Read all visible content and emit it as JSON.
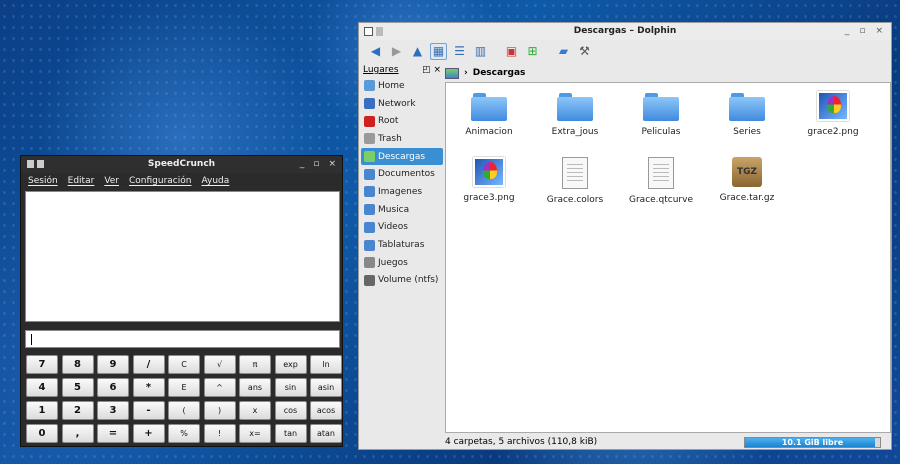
{
  "speedcrunch": {
    "title": "SpeedCrunch",
    "menu": [
      "Sesión",
      "Editar",
      "Ver",
      "Configuración",
      "Ayuda"
    ],
    "input_value": "",
    "keys": [
      [
        "7",
        "8",
        "9",
        "/",
        "C",
        "√",
        "π",
        "exp",
        "ln"
      ],
      [
        "4",
        "5",
        "6",
        "*",
        "E",
        "^",
        "ans",
        "sin",
        "asin"
      ],
      [
        "1",
        "2",
        "3",
        "-",
        "(",
        ")",
        "x",
        "cos",
        "acos"
      ],
      [
        "0",
        ",",
        "=",
        "+",
        "%",
        "!",
        "x=",
        "tan",
        "atan"
      ]
    ]
  },
  "dolphin": {
    "title": "Descargas – Dolphin",
    "places": {
      "header": "Lugares",
      "items": [
        {
          "label": "Home",
          "icon": "home-icon",
          "color": "#5b9ad8"
        },
        {
          "label": "Network",
          "icon": "network-icon",
          "color": "#3a6fc0"
        },
        {
          "label": "Root",
          "icon": "root-folder-icon",
          "color": "#d02020"
        },
        {
          "label": "Trash",
          "icon": "trash-icon",
          "color": "#9a9a9a"
        },
        {
          "label": "Descargas",
          "icon": "downloads-icon",
          "color": "#7ccf66",
          "selected": true
        },
        {
          "label": "Documentos",
          "icon": "documents-icon",
          "color": "#4a86d0"
        },
        {
          "label": "Imagenes",
          "icon": "images-icon",
          "color": "#4a86d0"
        },
        {
          "label": "Musica",
          "icon": "music-icon",
          "color": "#4a86d0"
        },
        {
          "label": "Videos",
          "icon": "videos-icon",
          "color": "#4a86d0"
        },
        {
          "label": "Tablaturas",
          "icon": "tablaturas-icon",
          "color": "#4a86d0"
        },
        {
          "label": "Juegos",
          "icon": "games-icon",
          "color": "#888888"
        },
        {
          "label": "Volume (ntfs)",
          "icon": "drive-icon",
          "color": "#666666"
        }
      ]
    },
    "breadcrumb": "Descargas",
    "files": [
      {
        "name": "Animacion",
        "kind": "folder"
      },
      {
        "name": "Extra_jous",
        "kind": "folder"
      },
      {
        "name": "Peliculas",
        "kind": "folder"
      },
      {
        "name": "Series",
        "kind": "folder"
      },
      {
        "name": "grace2.png",
        "kind": "png"
      },
      {
        "name": "grace3.png",
        "kind": "png"
      },
      {
        "name": "Grace.colors",
        "kind": "doc"
      },
      {
        "name": "Grace.qtcurve",
        "kind": "doc"
      },
      {
        "name": "Grace.tar.gz",
        "kind": "tgz",
        "badge": "TGZ"
      }
    ],
    "status_text": "4 carpetas, 5 archivos (110,8 kiB)",
    "free_space": {
      "label": "10.1 GiB libre",
      "used_fraction": 0.96
    }
  }
}
